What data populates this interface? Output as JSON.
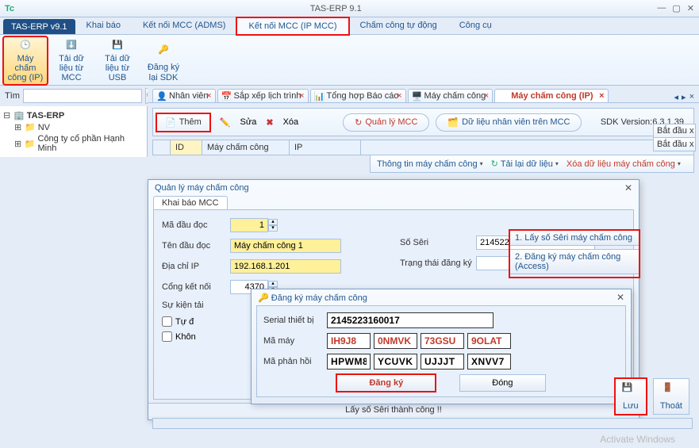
{
  "window": {
    "title": "TAS-ERP 9.1"
  },
  "menu": {
    "app": "TAS-ERP v9.1",
    "items": [
      "Khai báo",
      "Kết nối MCC (ADMS)",
      "Kết nối MCC (IP MCC)",
      "Chấm công tự động",
      "Công cụ"
    ],
    "active_index": 2
  },
  "ribbon": [
    {
      "label": "Máy chấm công (IP)"
    },
    {
      "label": "Tải dữ liệu từ MCC"
    },
    {
      "label": "Tải dữ liệu từ USB"
    },
    {
      "label": "Đăng ký lại SDK"
    }
  ],
  "search": {
    "label": "Tìm",
    "placeholder": ""
  },
  "tree": {
    "root": "TAS-ERP",
    "children": [
      "NV",
      "Công ty cổ phần Hạnh Minh"
    ]
  },
  "tabs": [
    {
      "label": "Nhân viên"
    },
    {
      "label": "Sắp xếp lịch trình"
    },
    {
      "label": "Tổng hợp  Báo cáo"
    },
    {
      "label": "Máy chấm công"
    },
    {
      "label": "Máy chấm công (IP)",
      "active": true
    }
  ],
  "toolbar": {
    "them": "Thêm",
    "sua": "Sửa",
    "xoa": "Xóa",
    "quanly": "Quản lý MCC",
    "dulieu": "Dữ liệu nhân viên trên MCC",
    "sdk": "SDK Version:6.3.1.39"
  },
  "grid_cols": [
    "",
    "ID",
    "Máy chấm công",
    "IP"
  ],
  "sub_toolbar": {
    "info": "Thông tin máy chấm công",
    "reload": "Tải lại dữ liệu",
    "delete": "Xóa dữ liệu máy chấm công"
  },
  "right_panel": {
    "hdr1": "Bắt đầu x",
    "hdr2": "Bắt đầu x"
  },
  "modal_qlmcc": {
    "title": "Quản lý máy chấm công",
    "tab": "Khai báo MCC",
    "fields": {
      "ma_dau_doc_lbl": "Mã đầu đọc",
      "ma_dau_doc": "1",
      "ten_lbl": "Tên đầu đọc",
      "ten": "Máy chấm công 1",
      "ip_lbl": "Địa chỉ IP",
      "ip": "192.168.1.201",
      "port_lbl": "Cổng kết nối",
      "port": "4370",
      "eventload_lbl": "Sự kiện tải",
      "seri_lbl": "Số Sêri",
      "seri": "2145223160017",
      "status_lbl": "Trạng thái đăng ký",
      "status": "",
      "cb1": "Tự đ",
      "cb2": "Khôn"
    },
    "side_btns": [
      "1. Lấy số Sêri máy chấm công",
      "2. Đăng ký máy chấm công (Access)"
    ],
    "footer": "Lấy số Sêri thành công !!"
  },
  "modal_dangky": {
    "title": "Đăng ký máy chấm công",
    "lbl_serial": "Serial thiết bị",
    "serial": "2145223160017",
    "lbl_mamay": "Mã máy",
    "mamay": [
      "IH9J8",
      "0NMVK",
      "73GSU",
      "9OLAT"
    ],
    "lbl_phanhoi": "Mã phản hồi",
    "phanhoi": [
      "HPWM8",
      "YCUVK",
      "UJJJT",
      "XNVV7"
    ],
    "btn_dk": "Đăng ký",
    "btn_dong": "Đóng"
  },
  "save_thoat": {
    "luu": "Lưu",
    "thoat": "Thoát"
  },
  "watermark": "Activate Windows"
}
